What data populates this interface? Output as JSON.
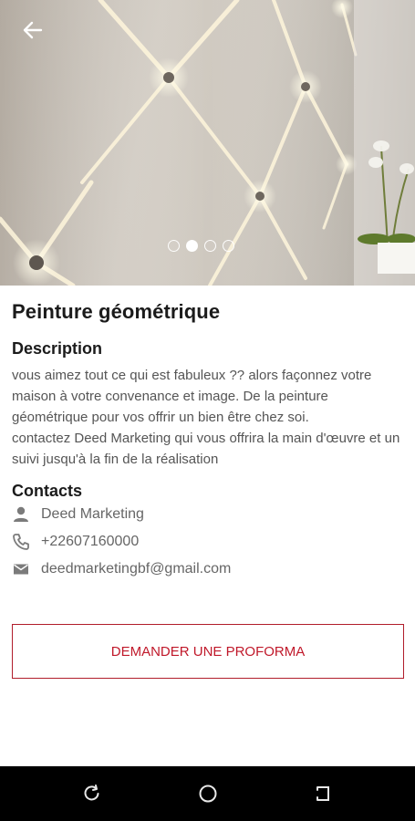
{
  "header": {
    "back_icon": "arrow-left-icon",
    "carousel": {
      "count": 4,
      "active_index": 1
    }
  },
  "product": {
    "title": "Peinture géométrique",
    "description_heading": "Description",
    "description": "vous aimez tout ce qui est fabuleux ?? alors façonnez votre maison à votre convenance et image. De la peinture géométrique pour vos offrir un bien être chez soi.\ncontactez Deed Marketing qui vous offrira la  main d'œuvre et un suivi jusqu'à la fin de la réalisation"
  },
  "contacts": {
    "heading": "Contacts",
    "name": "Deed Marketing",
    "phone": "+22607160000",
    "email": "deedmarketingbf@gmail.com"
  },
  "actions": {
    "proforma_label": "DEMANDER UNE PROFORMA"
  },
  "colors": {
    "accent": "#c0182a",
    "navbar": "#000000"
  },
  "navbar": {
    "items": [
      "recent-apps-icon",
      "home-icon",
      "back-icon"
    ]
  }
}
